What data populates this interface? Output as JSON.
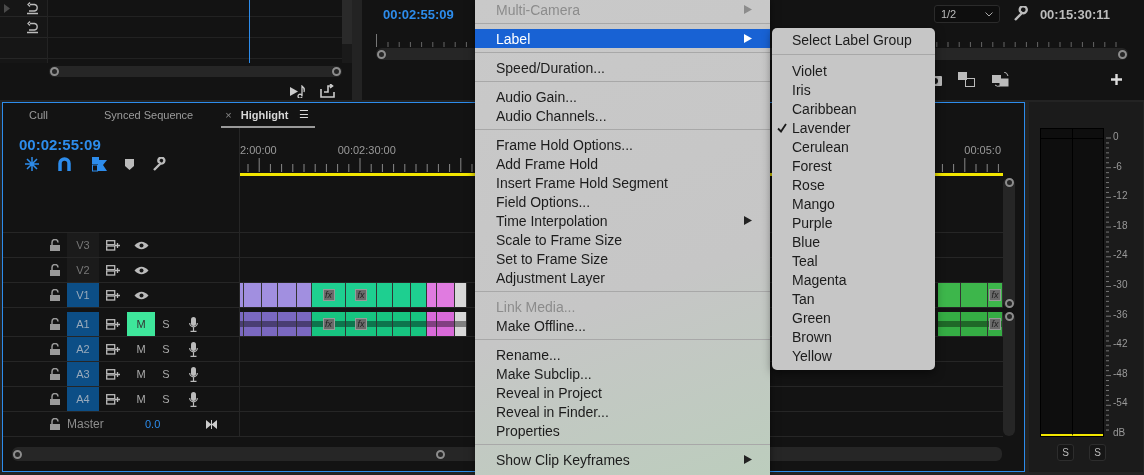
{
  "program_monitor": {
    "timecode": "00:02:55:09",
    "resolution": "1/2",
    "duration": "00:15:30:11"
  },
  "timeline": {
    "tabs": [
      {
        "label": "Cull",
        "selected": false
      },
      {
        "label": "Synced Sequence",
        "selected": false
      },
      {
        "label": "Highlight",
        "selected": true,
        "close": "×",
        "menu": "☰"
      }
    ],
    "timecode": "00:02:55:09",
    "ruler": [
      "2:00:00",
      "00:02:30:00",
      "00:05:0"
    ],
    "tracks": [
      {
        "kind": "video",
        "name": "V3",
        "targeted": false
      },
      {
        "kind": "video",
        "name": "V2",
        "targeted": false
      },
      {
        "kind": "video",
        "name": "V1",
        "targeted": true,
        "clips": [
          {
            "color": "#a18fe0"
          },
          {
            "color": "#a18fe0"
          },
          {
            "color": "#a18fe0"
          },
          {
            "color": "#a18fe0"
          },
          {
            "color": "#a18fe0"
          },
          {
            "color": "#1ecf90",
            "badge": "fx"
          },
          {
            "color": "#1ecf90",
            "badge": "fx"
          },
          {
            "color": "#1ecf90"
          },
          {
            "color": "#1ecf90"
          },
          {
            "color": "#1ecf90"
          },
          {
            "color": "#e07be0"
          },
          {
            "color": "#e07be0"
          },
          {
            "color": "#d8d8d8"
          },
          {
            "color": "#3db64b"
          },
          {
            "color": "#3db64b"
          },
          {
            "color": "#3db64b",
            "badge": "fx"
          }
        ]
      },
      {
        "kind": "audio",
        "name": "A1",
        "targeted": true,
        "muted": true,
        "mute": "M",
        "solo": "S",
        "clips": [
          {
            "color": "#7a68c0"
          },
          {
            "color": "#7a68c0"
          },
          {
            "color": "#7a68c0"
          },
          {
            "color": "#7a68c0"
          },
          {
            "color": "#7a68c0"
          },
          {
            "color": "#17c480",
            "badge": "fx"
          },
          {
            "color": "#17c480",
            "badge": "fx"
          },
          {
            "color": "#17c480"
          },
          {
            "color": "#17c480"
          },
          {
            "color": "#17c480"
          },
          {
            "color": "#d96ad9"
          },
          {
            "color": "#d96ad9"
          },
          {
            "color": "#d8d8d8"
          },
          {
            "color": "#35ad44"
          },
          {
            "color": "#35ad44"
          },
          {
            "color": "#35ad44",
            "badge": "fx"
          }
        ]
      },
      {
        "kind": "audio",
        "name": "A2",
        "targeted": true,
        "muted": false,
        "mute": "M",
        "solo": "S"
      },
      {
        "kind": "audio",
        "name": "A3",
        "targeted": true,
        "muted": false,
        "mute": "M",
        "solo": "S"
      },
      {
        "kind": "audio",
        "name": "A4",
        "targeted": true,
        "muted": false,
        "mute": "M",
        "solo": "S"
      }
    ],
    "master": {
      "name": "Master",
      "value": "0.0"
    }
  },
  "audio_meter": {
    "scale": [
      "0",
      "-6",
      "-12",
      "-18",
      "-24",
      "-30",
      "-36",
      "-42",
      "-48",
      "-54",
      "dB"
    ],
    "solo_buttons": [
      "S",
      "S"
    ]
  },
  "context_menu": {
    "items": [
      {
        "kind": "item",
        "label": "Multi-Camera",
        "disabled": true,
        "selected": false,
        "submenu": true
      },
      {
        "kind": "separator"
      },
      {
        "kind": "item",
        "label": "Label",
        "disabled": false,
        "selected": true,
        "submenu": true
      },
      {
        "kind": "separator"
      },
      {
        "kind": "item",
        "label": "Speed/Duration...",
        "disabled": false,
        "selected": false,
        "submenu": false
      },
      {
        "kind": "separator"
      },
      {
        "kind": "item",
        "label": "Audio Gain...",
        "disabled": false,
        "selected": false,
        "submenu": false
      },
      {
        "kind": "item",
        "label": "Audio Channels...",
        "disabled": false,
        "selected": false,
        "submenu": false
      },
      {
        "kind": "separator"
      },
      {
        "kind": "item",
        "label": "Frame Hold Options...",
        "disabled": false,
        "selected": false,
        "submenu": false
      },
      {
        "kind": "item",
        "label": "Add Frame Hold",
        "disabled": false,
        "selected": false,
        "submenu": false
      },
      {
        "kind": "item",
        "label": "Insert Frame Hold Segment",
        "disabled": false,
        "selected": false,
        "submenu": false
      },
      {
        "kind": "item",
        "label": "Field Options...",
        "disabled": false,
        "selected": false,
        "submenu": false
      },
      {
        "kind": "item",
        "label": "Time Interpolation",
        "disabled": false,
        "selected": false,
        "submenu": true
      },
      {
        "kind": "item",
        "label": "Scale to Frame Size",
        "disabled": false,
        "selected": false,
        "submenu": false
      },
      {
        "kind": "item",
        "label": "Set to Frame Size",
        "disabled": false,
        "selected": false,
        "submenu": false
      },
      {
        "kind": "item",
        "label": "Adjustment Layer",
        "disabled": false,
        "selected": false,
        "submenu": false
      },
      {
        "kind": "separator"
      },
      {
        "kind": "item",
        "label": "Link Media...",
        "disabled": true,
        "selected": false,
        "submenu": false
      },
      {
        "kind": "item",
        "label": "Make Offline...",
        "disabled": false,
        "selected": false,
        "submenu": false
      },
      {
        "kind": "separator"
      },
      {
        "kind": "item",
        "label": "Rename...",
        "disabled": false,
        "selected": false,
        "submenu": false
      },
      {
        "kind": "item",
        "label": "Make Subclip...",
        "disabled": false,
        "selected": false,
        "submenu": false
      },
      {
        "kind": "item",
        "label": "Reveal in Project",
        "disabled": false,
        "selected": false,
        "submenu": false
      },
      {
        "kind": "item",
        "label": "Reveal in Finder...",
        "disabled": false,
        "selected": false,
        "submenu": false
      },
      {
        "kind": "item",
        "label": "Properties",
        "disabled": false,
        "selected": false,
        "submenu": false
      },
      {
        "kind": "separator"
      },
      {
        "kind": "item",
        "label": "Show Clip Keyframes",
        "disabled": false,
        "selected": false,
        "submenu": true
      }
    ]
  },
  "label_submenu": {
    "items": [
      {
        "kind": "item",
        "label": "Select Label Group"
      },
      {
        "kind": "separator"
      },
      {
        "kind": "label",
        "label": "Violet",
        "checked": false
      },
      {
        "kind": "label",
        "label": "Iris",
        "checked": false
      },
      {
        "kind": "label",
        "label": "Caribbean",
        "checked": false
      },
      {
        "kind": "label",
        "label": "Lavender",
        "checked": true
      },
      {
        "kind": "label",
        "label": "Cerulean",
        "checked": false
      },
      {
        "kind": "label",
        "label": "Forest",
        "checked": false
      },
      {
        "kind": "label",
        "label": "Rose",
        "checked": false
      },
      {
        "kind": "label",
        "label": "Mango",
        "checked": false
      },
      {
        "kind": "label",
        "label": "Purple",
        "checked": false
      },
      {
        "kind": "label",
        "label": "Blue",
        "checked": false
      },
      {
        "kind": "label",
        "label": "Teal",
        "checked": false
      },
      {
        "kind": "label",
        "label": "Magenta",
        "checked": false
      },
      {
        "kind": "label",
        "label": "Tan",
        "checked": false
      },
      {
        "kind": "label",
        "label": "Green",
        "checked": false
      },
      {
        "kind": "label",
        "label": "Brown",
        "checked": false
      },
      {
        "kind": "label",
        "label": "Yellow",
        "checked": false
      }
    ]
  }
}
